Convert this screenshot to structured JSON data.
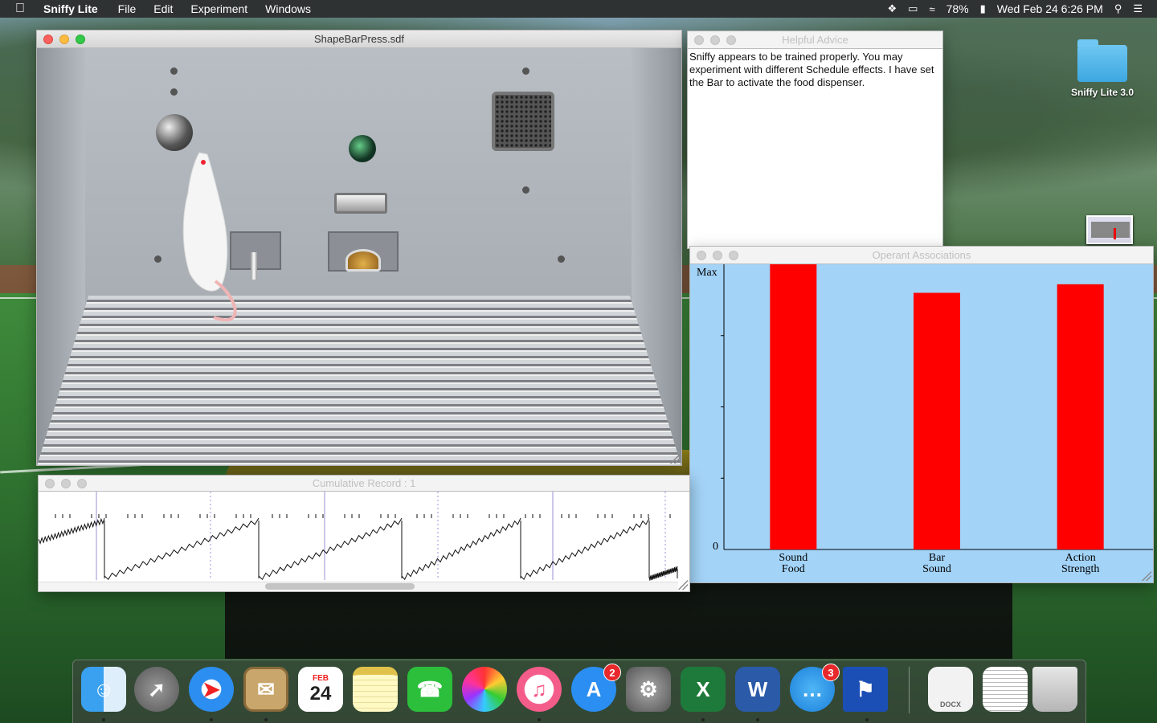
{
  "menubar": {
    "app_name": "Sniffy Lite",
    "menus": [
      "File",
      "Edit",
      "Experiment",
      "Windows"
    ],
    "battery": "78%",
    "datetime": "Wed Feb 24  6:26 PM"
  },
  "windows": {
    "chamber": {
      "title": "ShapeBarPress.sdf"
    },
    "advice": {
      "title": "Helpful Advice",
      "text": "Sniffy appears to be trained properly. You may experiment with different Schedule effects. I have set the Bar to activate the food dispenser."
    },
    "associations": {
      "title": "Operant Associations"
    },
    "cumulative": {
      "title": "Cumulative Record : 1"
    }
  },
  "chart_data": {
    "type": "bar",
    "categories": [
      "Sound Food",
      "Bar Sound",
      "Action Strength"
    ],
    "category_lines": [
      [
        "Sound",
        "Food"
      ],
      [
        "Bar",
        "Sound"
      ],
      [
        "Action",
        "Strength"
      ]
    ],
    "values": [
      1.0,
      0.9,
      0.93
    ],
    "ylim": [
      0,
      1
    ],
    "ytick_labels": {
      "max": "Max",
      "min": "0"
    },
    "bar_color": "#ff0000",
    "background": "#a3d3f7",
    "grid": false
  },
  "desktop": {
    "folder_label": "Sniffy Lite 3.0"
  },
  "dock": {
    "calendar": {
      "month": "FEB",
      "day": "24"
    },
    "app_store_badge": "2",
    "messages_badge": "3",
    "docx_label": "DOCX",
    "excel_letter": "X",
    "word_letter": "W"
  },
  "colors": {
    "bar": "#ff0000",
    "chart_bg": "#a3d3f7",
    "record_line": "#9b8fd6"
  }
}
